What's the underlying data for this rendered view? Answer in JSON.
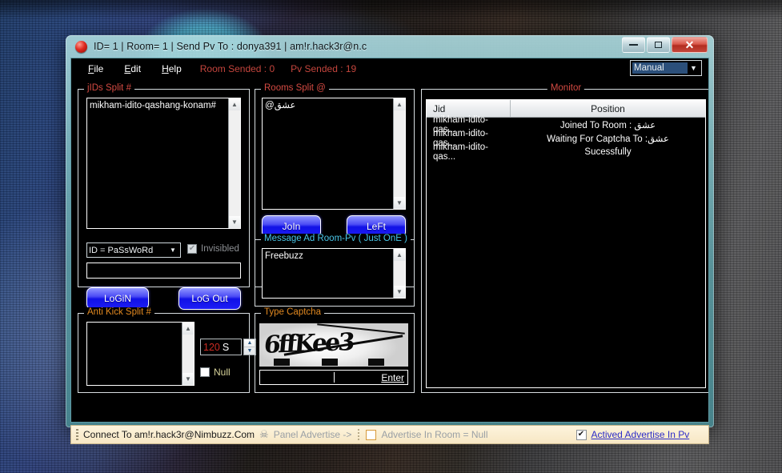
{
  "window": {
    "title": "ID= 1 | Room= 1 | Send Pv To : donya391 | am!r.hack3r@n.c",
    "icon": "red-sphere-icon",
    "minimize": "–",
    "maximize": "□",
    "close": "✕"
  },
  "menu": {
    "items": [
      {
        "label": "File",
        "mnemonic": "F"
      },
      {
        "label": "Edit",
        "mnemonic": "E"
      },
      {
        "label": "Help",
        "mnemonic": "H"
      }
    ],
    "room_sended": "Room Sended :  0",
    "pv_sended": "Pv Sended : 19"
  },
  "mode_combo": {
    "value": "Manual",
    "arrow": "▼"
  },
  "jids_panel": {
    "title": "jIDs Split #",
    "lines": [
      "mikham-idito-qashang-konam#"
    ]
  },
  "password_combo": {
    "value": "ID = PaSsWoRd",
    "arrow": "▼"
  },
  "invisible_checkbox": {
    "label": "Invisibled",
    "checked": true,
    "mark": "✔"
  },
  "plain_input": {
    "value": ""
  },
  "login_button": {
    "label": "LoGiN"
  },
  "logout_button": {
    "label": "LoG Out"
  },
  "rooms_panel": {
    "title": "Rooms Split @",
    "lines": [
      "@عشق"
    ]
  },
  "join_button": {
    "label": "JoIn"
  },
  "left_button": {
    "label": "LeFt"
  },
  "message_panel": {
    "title": "Message Ad Room-Pv ( Just OnE )",
    "lines": [
      "Freebuzz"
    ]
  },
  "antikick_panel": {
    "title": "Anti Kick Split #",
    "lines": [],
    "spinner_value": "120",
    "spinner_unit": "S",
    "null_checkbox": {
      "label": "Null",
      "checked": false,
      "mark": ""
    }
  },
  "captcha_panel": {
    "title": "Type Captcha",
    "image_text": "6ffKee3",
    "input_value": "",
    "enter_link": "Enter"
  },
  "monitor_panel": {
    "title": "Monitor",
    "columns": [
      "Jid",
      "Position"
    ],
    "rows": [
      {
        "jid": "mikham-idito-qas...",
        "position": "Joined To Room : عشق"
      },
      {
        "jid": "mikham-idito-qas...",
        "position": "Waiting For Captcha To :عشق"
      },
      {
        "jid": "mikham-idito-qas...",
        "position": "Sucessfully"
      }
    ]
  },
  "statusbar": {
    "connect": "Connect To am!r.hack3r@Nimbuzz.Com",
    "skull_icon": "☠",
    "panel_advertise": "Panel Advertise ->",
    "advertise_room": {
      "label": "Advertise In Room = Null",
      "checked": false,
      "mark": ""
    },
    "advertise_pv": {
      "label": "Actived Advertise In Pv",
      "checked": true,
      "mark": "✔"
    }
  },
  "scroll_arrows": {
    "up": "▲",
    "down": "▼"
  }
}
